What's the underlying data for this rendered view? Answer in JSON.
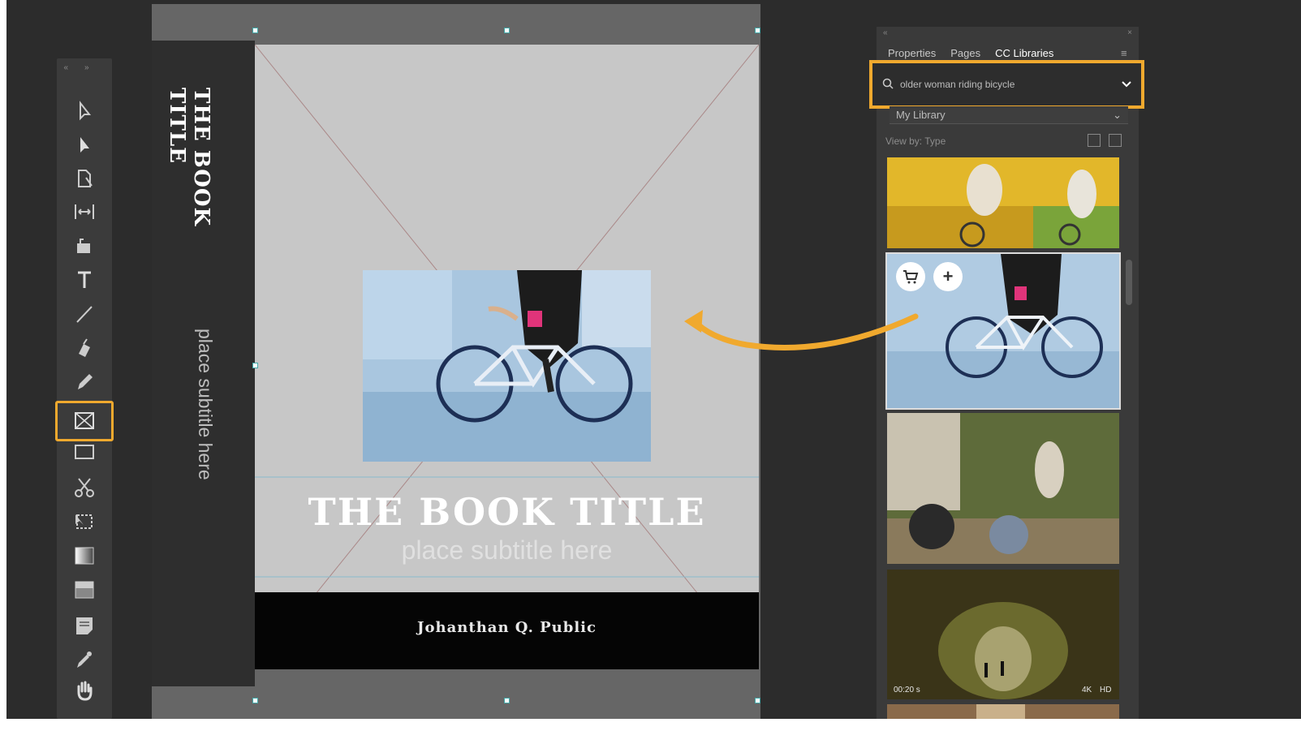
{
  "app": {
    "accent_color": "#f0a92e"
  },
  "document": {
    "spine_title": "THE BOOK TITLE",
    "spine_subtitle": "place subtitle here",
    "cover_title": "THE BOOK TITLE",
    "cover_subtitle": "place subtitle here",
    "author": "Johanthan Q. Public"
  },
  "toolbar": {
    "tools": [
      {
        "name": "selection-tool",
        "icon": "arrow-outline-icon"
      },
      {
        "name": "direct-selection-tool",
        "icon": "arrow-filled-icon"
      },
      {
        "name": "page-tool",
        "icon": "page-icon"
      },
      {
        "name": "gap-tool",
        "icon": "gap-icon"
      },
      {
        "name": "content-collector-tool",
        "icon": "bucket-icon"
      },
      {
        "name": "type-tool",
        "icon": "type-icon"
      },
      {
        "name": "line-tool",
        "icon": "line-icon"
      },
      {
        "name": "pen-tool",
        "icon": "pen-icon"
      },
      {
        "name": "pencil-tool",
        "icon": "pencil-icon"
      },
      {
        "name": "rectangle-frame-tool",
        "icon": "frame-x-icon",
        "active": true
      },
      {
        "name": "rectangle-tool",
        "icon": "rectangle-icon"
      },
      {
        "name": "scissors-tool",
        "icon": "scissors-icon"
      },
      {
        "name": "free-transform-tool",
        "icon": "transform-icon"
      },
      {
        "name": "gradient-swatch-tool",
        "icon": "gradient-icon"
      },
      {
        "name": "gradient-feather-tool",
        "icon": "feather-icon"
      },
      {
        "name": "note-tool",
        "icon": "note-icon"
      },
      {
        "name": "eyedropper-tool",
        "icon": "eyedropper-icon"
      },
      {
        "name": "hand-tool",
        "icon": "hand-icon"
      }
    ]
  },
  "panel": {
    "tabs": [
      "Properties",
      "Pages",
      "CC Libraries"
    ],
    "active_tab": "CC Libraries",
    "search_value": "older woman riding bicycle",
    "library": "My Library",
    "view_by": "View by: Type",
    "video_duration": "00:20 s",
    "video_badges": [
      "4K",
      "HD"
    ]
  }
}
